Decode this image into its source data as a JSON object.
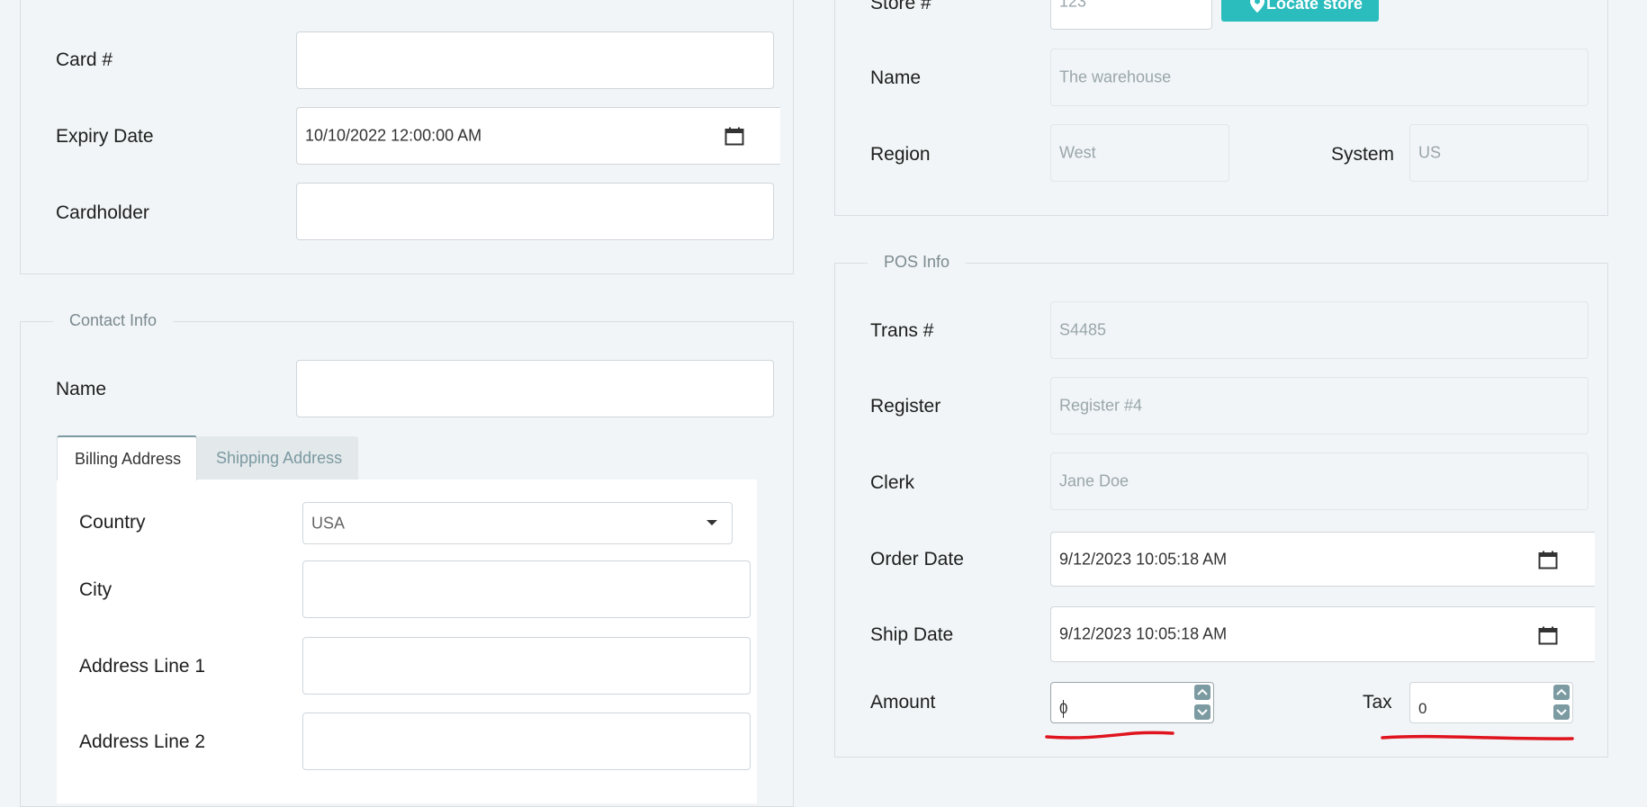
{
  "payment": {
    "card_label": "Card #",
    "card_value": "",
    "expiry_label": "Expiry Date",
    "expiry_value": "10/10/2022 12:00:00 AM",
    "cardholder_label": "Cardholder",
    "cardholder_value": ""
  },
  "contact": {
    "legend": "Contact Info",
    "name_label": "Name",
    "name_value": "",
    "tabs": [
      {
        "label": "Billing Address",
        "active": true
      },
      {
        "label": "Shipping Address",
        "active": false
      }
    ],
    "billing": {
      "country_label": "Country",
      "country_value": "USA",
      "city_label": "City",
      "city_value": "",
      "address1_label": "Address Line 1",
      "address1_value": "",
      "address2_label": "Address Line 2",
      "address2_value": ""
    }
  },
  "store": {
    "store_label": "Store #",
    "store_value": "123",
    "locate_button": "Locate store",
    "name_label": "Name",
    "name_value": "The warehouse",
    "region_label": "Region",
    "region_value": "West",
    "system_label": "System",
    "system_value": "US"
  },
  "pos": {
    "legend": "POS Info",
    "trans_label": "Trans #",
    "trans_value": "S4485",
    "register_label": "Register",
    "register_value": "Register #4",
    "clerk_label": "Clerk",
    "clerk_value": "Jane Doe",
    "order_date_label": "Order Date",
    "order_date_value": "9/12/2023 10:05:18 AM",
    "ship_date_label": "Ship Date",
    "ship_date_value": "9/12/2023 10:05:18 AM",
    "amount_label": "Amount",
    "amount_value": "0",
    "tax_label": "Tax",
    "tax_value": "0"
  },
  "colors": {
    "accent": "#2bbcbd",
    "background": "#f1f5f7",
    "annotation": "#e0141e"
  },
  "icons": [
    "calendar-icon",
    "chevron-down-icon",
    "map-pin-icon",
    "spin-up-icon",
    "spin-down-icon"
  ]
}
